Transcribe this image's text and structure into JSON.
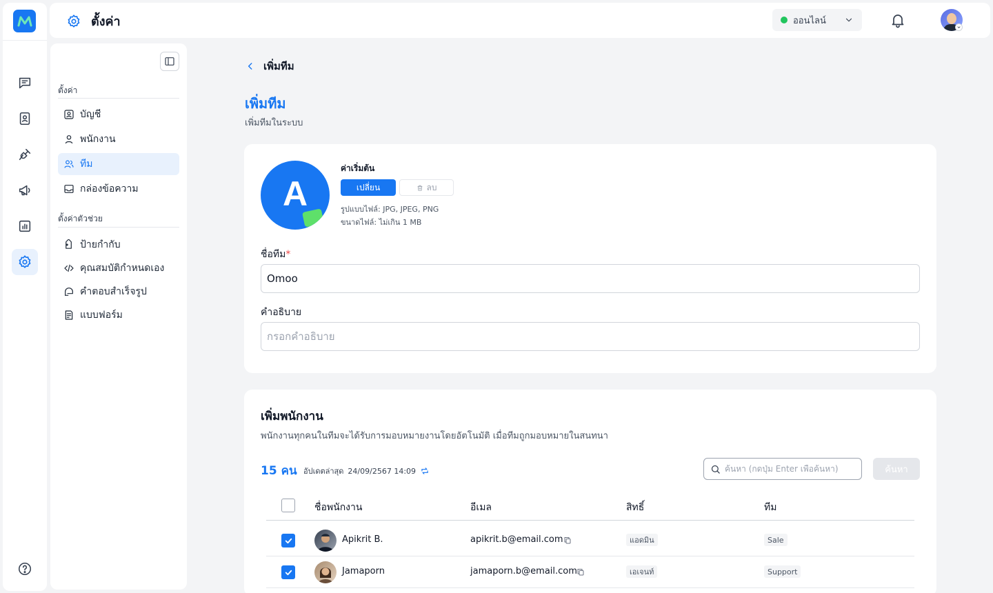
{
  "topbar": {
    "title": "ตั้งค่า",
    "status": "ออนไลน์",
    "status_color": "#22c55e"
  },
  "rail": {
    "icons": [
      "chat-icon",
      "contacts-icon",
      "plug-icon",
      "megaphone-icon",
      "chart-icon",
      "settings-icon",
      "help-icon"
    ],
    "active": "settings-icon"
  },
  "sidebar": {
    "section1": "ตั้งค่า",
    "items1": [
      {
        "label": "บัญชี",
        "icon": "user-square-icon"
      },
      {
        "label": "พนักงาน",
        "icon": "user-icon"
      },
      {
        "label": "ทีม",
        "icon": "users-icon",
        "active": true
      },
      {
        "label": "กล่องข้อความ",
        "icon": "inbox-icon"
      }
    ],
    "section2": "ตั้งค่าตัวช่วย",
    "items2": [
      {
        "label": "ป้ายกำกับ",
        "icon": "tag-icon"
      },
      {
        "label": "คุณสมบัติกำหนดเอง",
        "icon": "code-icon"
      },
      {
        "label": "คำตอบสำเร็จรูป",
        "icon": "quick-reply-icon"
      },
      {
        "label": "แบบฟอร์ม",
        "icon": "form-icon"
      }
    ]
  },
  "breadcrumb": {
    "label": "เพิ่มทีม"
  },
  "page": {
    "title": "เพิ่มทีม",
    "subtitle": "เพิ่มทีมในระบบ"
  },
  "team_form": {
    "avatar_letter": "A",
    "avatar_label": "ค่าเริ่มต้น",
    "change_label": "เปลี่ยน",
    "delete_label": "ลบ",
    "hint_type": "รูปแบบไฟล์: JPG, JPEG, PNG",
    "hint_size": "ขนาดไฟล์: ไม่เกิน 1 MB",
    "name_label": "ชื่อทีม",
    "required_mark": "*",
    "name_value": "Omoo",
    "desc_label": "คำอธิบาย",
    "desc_placeholder": "กรอกคำอธิบาย",
    "accent": "#1877f2"
  },
  "members": {
    "title": "เพิ่มพนักงาน",
    "description": "พนักงานทุกคนในทีมจะได้รับการมอบหมายงานโดยอัตโนมัติ เมื่อทีมถูกมอบหมายในสนทนา",
    "count": "15",
    "count_unit": "คน",
    "updated_label": "อัปเดตล่าสุด",
    "updated_value": "24/09/2567 14:09",
    "search_placeholder": "ค้นหา (กดปุ่ม Enter เพื่อค้นหา)",
    "search_button": "ค้นหา",
    "columns": [
      "ชื่อพนักงาน",
      "อีเมล",
      "สิทธิ์",
      "ทีม"
    ],
    "rows": [
      {
        "name": "Apikrit B.",
        "email": "apikrit.b@email.com",
        "role": "แอดมิน",
        "team": "Sale",
        "checked": true
      },
      {
        "name": "Jamaporn",
        "email": "jamaporn.b@email.com",
        "role": "เอเจนท์",
        "team": "Support",
        "checked": true
      }
    ]
  }
}
